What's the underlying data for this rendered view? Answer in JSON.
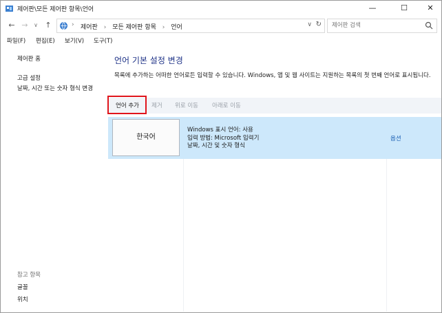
{
  "window": {
    "title": "제어판\\모든 제어판 항목\\언어",
    "minimize_glyph": "—",
    "maximize_glyph": "☐",
    "close_glyph": "✕"
  },
  "nav": {
    "back": "←",
    "forward": "→",
    "recent": "∨",
    "up": "↑",
    "breadcrumb_sep": "›",
    "breadcrumbs": [
      "제어판",
      "모든 제어판 항목",
      "언어"
    ],
    "dropdown": "∨",
    "refresh": "↻"
  },
  "search": {
    "placeholder": "제어판 검색"
  },
  "menu": [
    "파일(F)",
    "편집(E)",
    "보기(V)",
    "도구(T)"
  ],
  "sidebar": {
    "home": "제어판 홈",
    "links": [
      "고급 설정",
      "날짜, 시간 또는 숫자 형식 변경"
    ],
    "see_also_title": "참고 항목",
    "see_also": [
      "글꼴",
      "위치"
    ]
  },
  "main": {
    "title": "언어 기본 설정 변경",
    "description": "목록에 추가하는 어떠한 언어로든 입력할 수 있습니다. Windows, 앱 및 웹 사이트는 지원하는 목록의 첫 번째 언어로 표시됩니다.",
    "toolbar": {
      "add": "언어 추가",
      "remove": "제거",
      "move_up": "위로 이동",
      "move_down": "아래로 이동"
    },
    "language": {
      "name": "한국어",
      "display_language": "Windows 표시 언어: 사용",
      "input_method": "입력 방법: Microsoft 입력기",
      "format": "날짜, 시간 및 숫자 형식",
      "options": "옵션"
    }
  },
  "colors": {
    "title": "#1e3287",
    "selected_row": "#cde8fb",
    "toolbar_bg": "#f1f4f8",
    "highlight": "#e0141b",
    "link": "#1a5fb4"
  }
}
